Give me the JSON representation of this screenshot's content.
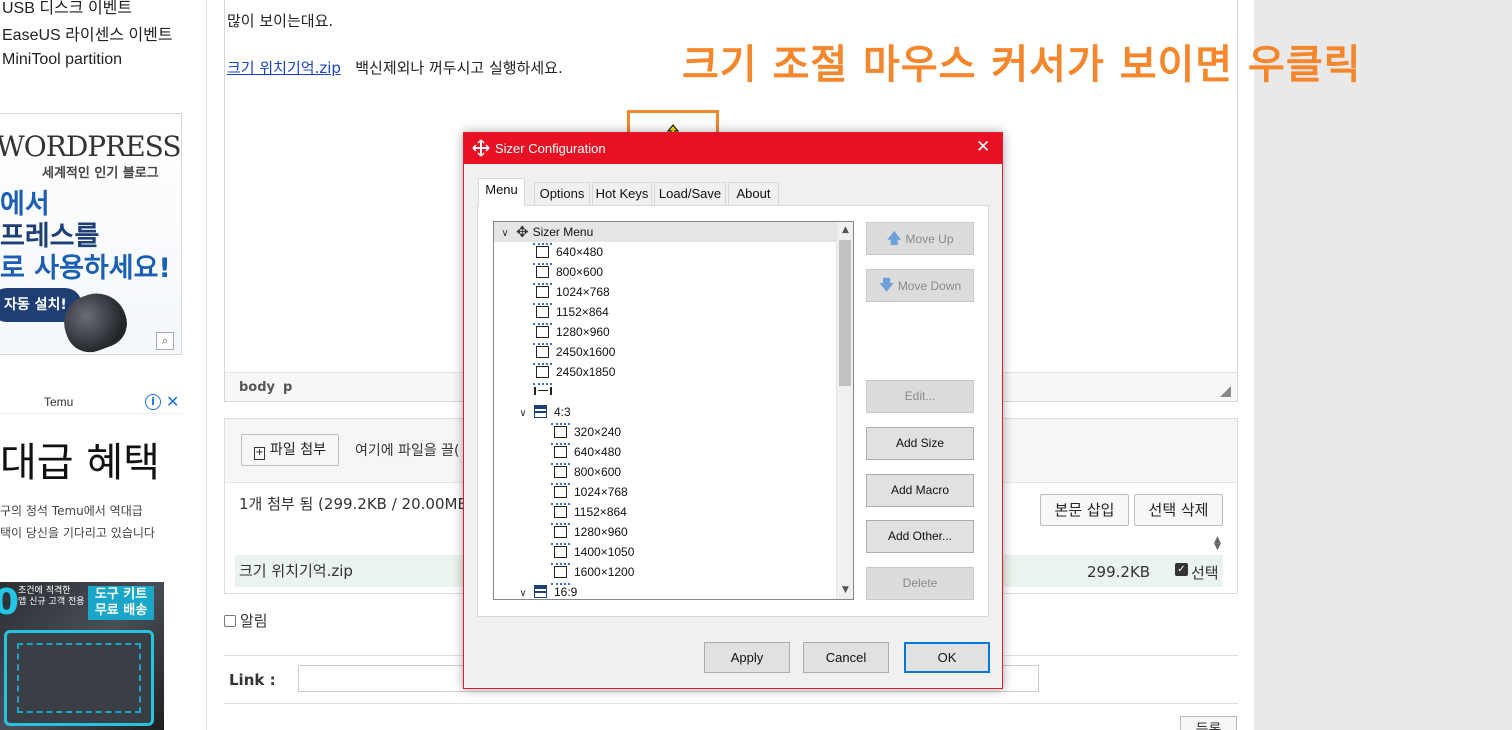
{
  "sidebar": {
    "links": [
      "USB 디스크 이벤트",
      "EaseUS 라이센스 이벤트",
      "MiniTool partition"
    ],
    "wp_ad": {
      "logo": "WORDPRESS",
      "subtitle": "세계적인 인기 블로그",
      "line1": "에서",
      "line2": "프레스를",
      "line3": "로 사용하세요!",
      "button": "자동 설치!"
    },
    "temu_ad": {
      "brand": "Temu",
      "headline": "대급 혜택",
      "desc1": "구의 정석 Temu에서 역대급",
      "desc2": "택이 당신을 기다리고 있습니다",
      "badge_line1": "도구 키트",
      "badge_line2": "무료 배송",
      "small_text1": "조건에 적격한",
      "small_text2": "앱 신규 고객 전용",
      "zero": "0"
    }
  },
  "editor": {
    "line1": "많이 보이는대요.",
    "link_text": "크기 위치기억.zip",
    "line2_rest": "백신제외나 꺼두시고 실행하세요.",
    "path_body": "body",
    "path_p": "p"
  },
  "annotation": "크기 조절 마우스 커서가 보이면 우클릭",
  "attach": {
    "button_label": "파일 첨부",
    "drop_hint": "여기에 파일을 끌(",
    "status": "1개 첨부 됨 (299.2KB / 20.00MB",
    "insert_button": "본문 삽입",
    "delete_button": "선택 삭제",
    "file_name": "크기 위치기억.zip",
    "file_size": "299.2KB",
    "select_label": "선택"
  },
  "notify_label": "알림",
  "link_label": "Link :",
  "register_label": "등록",
  "dialog": {
    "title": "Sizer Configuration",
    "tabs": [
      "Menu",
      "Options",
      "Hot Keys",
      "Load/Save",
      "About"
    ],
    "tree": {
      "root": "Sizer Menu",
      "top_sizes": [
        "640×480",
        "800×600",
        "1024×768",
        "1152×864",
        "1280×960",
        "2450x1600",
        "2450x1850"
      ],
      "group1": "4:3",
      "group1_sizes": [
        "320×240",
        "640×480",
        "800×600",
        "1024×768",
        "1152×864",
        "1280×960",
        "1400×1050",
        "1600×1200"
      ],
      "group2": "16:9"
    },
    "buttons": {
      "move_up": "Move Up",
      "move_down": "Move Down",
      "edit": "Edit...",
      "add_size": "Add Size",
      "add_macro": "Add Macro",
      "add_other": "Add Other...",
      "delete": "Delete"
    },
    "footer": {
      "apply": "Apply",
      "cancel": "Cancel",
      "ok": "OK"
    }
  },
  "colors": {
    "titlebar": "#e81123",
    "annotation": "#f4862c",
    "link": "#1a44c8"
  }
}
